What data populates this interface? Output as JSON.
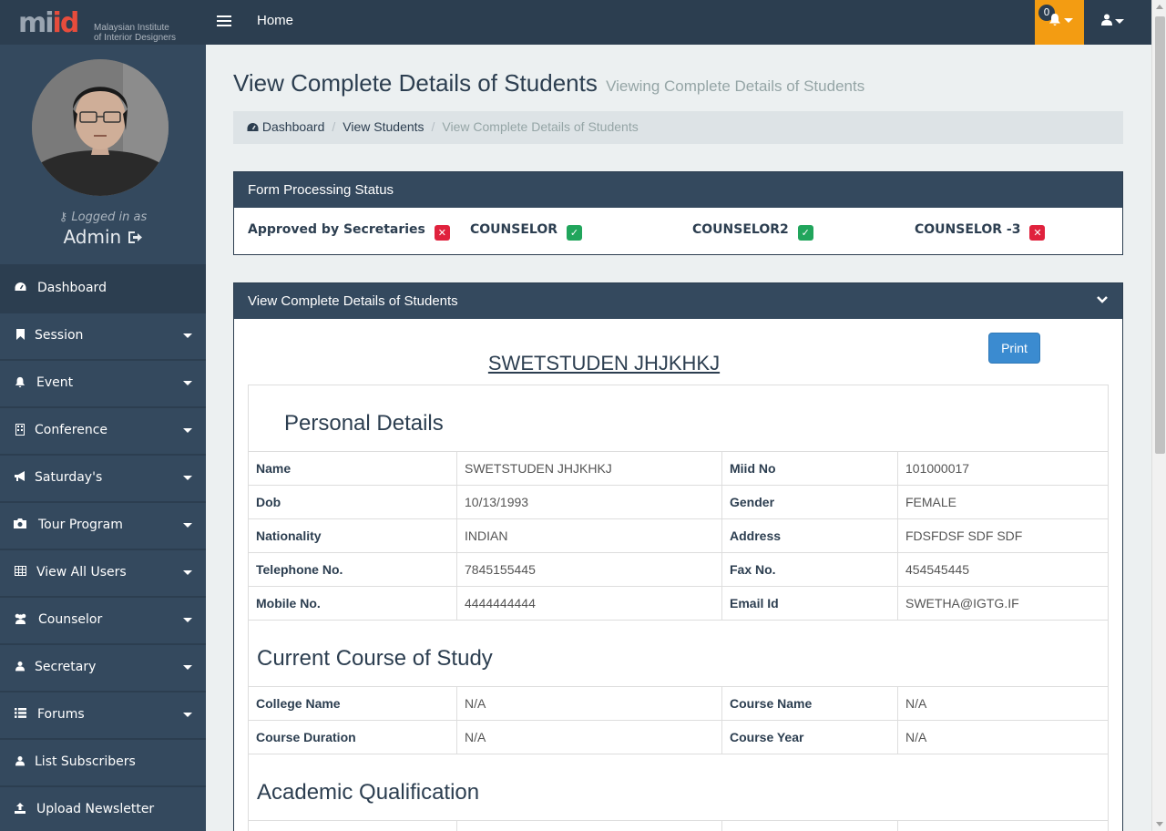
{
  "header": {
    "logo_mark_left": "mi",
    "logo_mark_right": "id",
    "logo_line1": "Malaysian Institute",
    "logo_line2": "of Interior Designers",
    "home_label": "Home",
    "notification_count": "0"
  },
  "sidebar": {
    "logged_in_label": "Logged in as",
    "user_name": "Admin",
    "items": [
      {
        "label": "Dashboard",
        "icon": "dashboard-icon"
      },
      {
        "label": "Session",
        "icon": "bookmark-icon"
      },
      {
        "label": "Event",
        "icon": "bell-icon"
      },
      {
        "label": "Conference",
        "icon": "building-icon"
      },
      {
        "label": "Saturday's",
        "icon": "bullhorn-icon"
      },
      {
        "label": "Tour Program",
        "icon": "camera-icon"
      },
      {
        "label": "View All Users",
        "icon": "table-icon"
      },
      {
        "label": "Counselor",
        "icon": "users-icon"
      },
      {
        "label": "Secretary",
        "icon": "user-icon"
      },
      {
        "label": "Forums",
        "icon": "list-icon"
      },
      {
        "label": "List Subscribers",
        "icon": "user-icon"
      },
      {
        "label": "Upload Newsletter",
        "icon": "upload-icon"
      }
    ]
  },
  "page": {
    "title": "View Complete Details of Students",
    "subtitle": "Viewing Complete Details of Students",
    "breadcrumb": [
      "Dashboard",
      "View Students",
      "View Complete Details of Students"
    ]
  },
  "status_panel": {
    "title": "Form Processing Status",
    "items": [
      {
        "label": "Approved by Secretaries",
        "approved": false
      },
      {
        "label": "COUNSELOR",
        "approved": true
      },
      {
        "label": "COUNSELOR2",
        "approved": true
      },
      {
        "label": "COUNSELOR -3",
        "approved": false
      }
    ]
  },
  "details_panel": {
    "title": "View Complete Details of Students",
    "print_label": "Print",
    "student_name": "SWETSTUDEN JHJKHKJ",
    "personal": {
      "heading": "Personal Details",
      "rows": [
        [
          "Name",
          "SWETSTUDEN JHJKHKJ",
          "Miid No",
          "101000017"
        ],
        [
          "Dob",
          "10/13/1993",
          "Gender",
          "FEMALE"
        ],
        [
          "Nationality",
          "INDIAN",
          "Address",
          "FDSFDSF SDF SDF"
        ],
        [
          "Telephone No.",
          "7845155445",
          "Fax No.",
          "454545445"
        ],
        [
          "Mobile No.",
          "4444444444",
          "Email Id",
          "SWETHA@IGTG.IF"
        ]
      ]
    },
    "course": {
      "heading": "Current Course of Study",
      "rows": [
        [
          "College Name",
          "N/A",
          "Course Name",
          "N/A"
        ],
        [
          "Course Duration",
          "N/A",
          "Course Year",
          "N/A"
        ]
      ]
    },
    "academic": {
      "heading": "Academic Qualification"
    }
  },
  "colors": {
    "topbar": "#2c3e50",
    "sidebar": "#34495e",
    "notification": "#f39c12",
    "approved": "#21a55c",
    "rejected": "#e0223d",
    "print_button": "#3b8bd0"
  }
}
